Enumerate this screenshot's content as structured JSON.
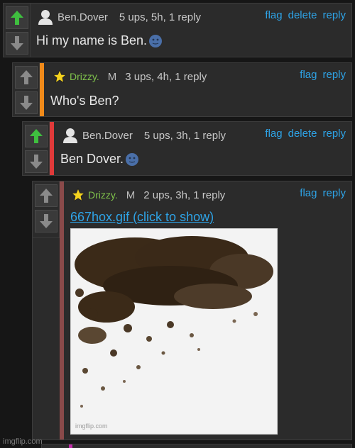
{
  "comments": [
    {
      "username": "Ben.Dover",
      "meta": "5 ups, 5h, 1 reply",
      "actions": [
        "flag",
        "delete",
        "reply"
      ],
      "body": "Hi my name is Ben.",
      "body_emoji": "new-moon-face"
    },
    {
      "username": "Drizzy.",
      "mod_badge": "M",
      "meta": "3 ups, 4h, 1 reply",
      "actions": [
        "flag",
        "reply"
      ],
      "body": "Who's Ben?"
    },
    {
      "username": "Ben.Dover",
      "meta": "5 ups, 3h, 1 reply",
      "actions": [
        "flag",
        "delete",
        "reply"
      ],
      "body": "Ben Dover.",
      "body_emoji": "new-moon-face"
    },
    {
      "username": "Drizzy.",
      "mod_badge": "M",
      "meta": "2 ups, 3h, 1 reply",
      "actions": [
        "flag",
        "reply"
      ],
      "link": "667hox.gif (click to show)",
      "gif_watermark": "imgflip.com"
    }
  ],
  "footer_watermark": "imgflip.com",
  "colors": {
    "accent_link": "#2ea3e6",
    "upvote": "#3fbf3f",
    "stripe_orange": "#f08a1a",
    "stripe_red": "#e03a3a",
    "stripe_maroon": "#8a4a4a",
    "mod_name": "#7fc24b"
  }
}
